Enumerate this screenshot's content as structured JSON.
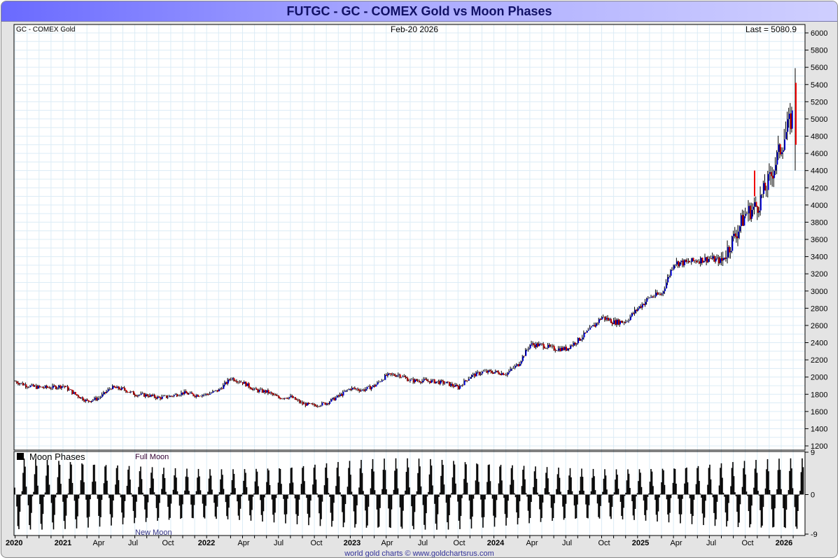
{
  "header": {
    "title": "FUTGC - GC - COMEX Gold vs Moon Phases"
  },
  "footer": {
    "text": "world gold charts © www.goldchartsrus.com"
  },
  "chart_data": [
    {
      "type": "line",
      "title": "GC - COMEX Gold",
      "date_label": "Feb-20  2026",
      "last_label": "Last = 5080.9",
      "last_value": 5080.9,
      "ylim": [
        1200,
        6000
      ],
      "yticks": [
        1200,
        1400,
        1600,
        1800,
        2000,
        2200,
        2400,
        2600,
        2800,
        3000,
        3200,
        3400,
        3600,
        3800,
        4000,
        4200,
        4400,
        4600,
        4800,
        5000,
        5200,
        5400,
        5600,
        5800,
        6000
      ],
      "grid": true,
      "colors": {
        "up": "#0000ee",
        "down": "#ee0000",
        "wick": "#000000"
      },
      "x": [
        "2020-09",
        "2020-10",
        "2020-11",
        "2020-12",
        "2021-01",
        "2021-02",
        "2021-03",
        "2021-04",
        "2021-05",
        "2021-06",
        "2021-07",
        "2021-08",
        "2021-09",
        "2021-10",
        "2021-11",
        "2021-12",
        "2022-01",
        "2022-02",
        "2022-03",
        "2022-04",
        "2022-05",
        "2022-06",
        "2022-07",
        "2022-08",
        "2022-09",
        "2022-10",
        "2022-11",
        "2022-12",
        "2023-01",
        "2023-02",
        "2023-03",
        "2023-04",
        "2023-05",
        "2023-06",
        "2023-07",
        "2023-08",
        "2023-09",
        "2023-10",
        "2023-11",
        "2023-12",
        "2024-01",
        "2024-02",
        "2024-03",
        "2024-04",
        "2024-05",
        "2024-06",
        "2024-07",
        "2024-08",
        "2024-09",
        "2024-10",
        "2024-11",
        "2024-12",
        "2025-01",
        "2025-02",
        "2025-03",
        "2025-04",
        "2025-05",
        "2025-06",
        "2025-07",
        "2025-08",
        "2025-09",
        "2025-10",
        "2025-11",
        "2025-12",
        "2026-01",
        "2026-02"
      ],
      "values": [
        1950,
        1900,
        1880,
        1880,
        1900,
        1800,
        1720,
        1760,
        1880,
        1860,
        1800,
        1790,
        1760,
        1780,
        1820,
        1790,
        1800,
        1850,
        1990,
        1940,
        1850,
        1830,
        1760,
        1770,
        1690,
        1670,
        1700,
        1780,
        1870,
        1850,
        1900,
        2020,
        2030,
        1960,
        1960,
        1950,
        1930,
        1880,
        2010,
        2060,
        2060,
        2040,
        2150,
        2380,
        2370,
        2330,
        2330,
        2430,
        2550,
        2700,
        2640,
        2650,
        2800,
        2930,
        2970,
        3330,
        3330,
        3360,
        3380,
        3350,
        3620,
        3900,
        4000,
        4300,
        4700,
        5080.9
      ]
    },
    {
      "type": "area",
      "title": "Moon Phases",
      "top_label": "Full Moon",
      "bottom_label": "New Moon",
      "ylim": [
        -9,
        9
      ],
      "yticks": [
        "9",
        "0",
        "-9"
      ],
      "cycle_days": 29.53
    }
  ],
  "x_axis": {
    "labels": [
      "2020",
      "2021",
      "Apr",
      "Jul",
      "Oct",
      "2022",
      "Apr",
      "Jul",
      "Oct",
      "2023",
      "Apr",
      "Jul",
      "Oct",
      "2024",
      "Apr",
      "Jul",
      "Oct",
      "2025",
      "Apr",
      "Jul",
      "Oct",
      "2026"
    ]
  }
}
